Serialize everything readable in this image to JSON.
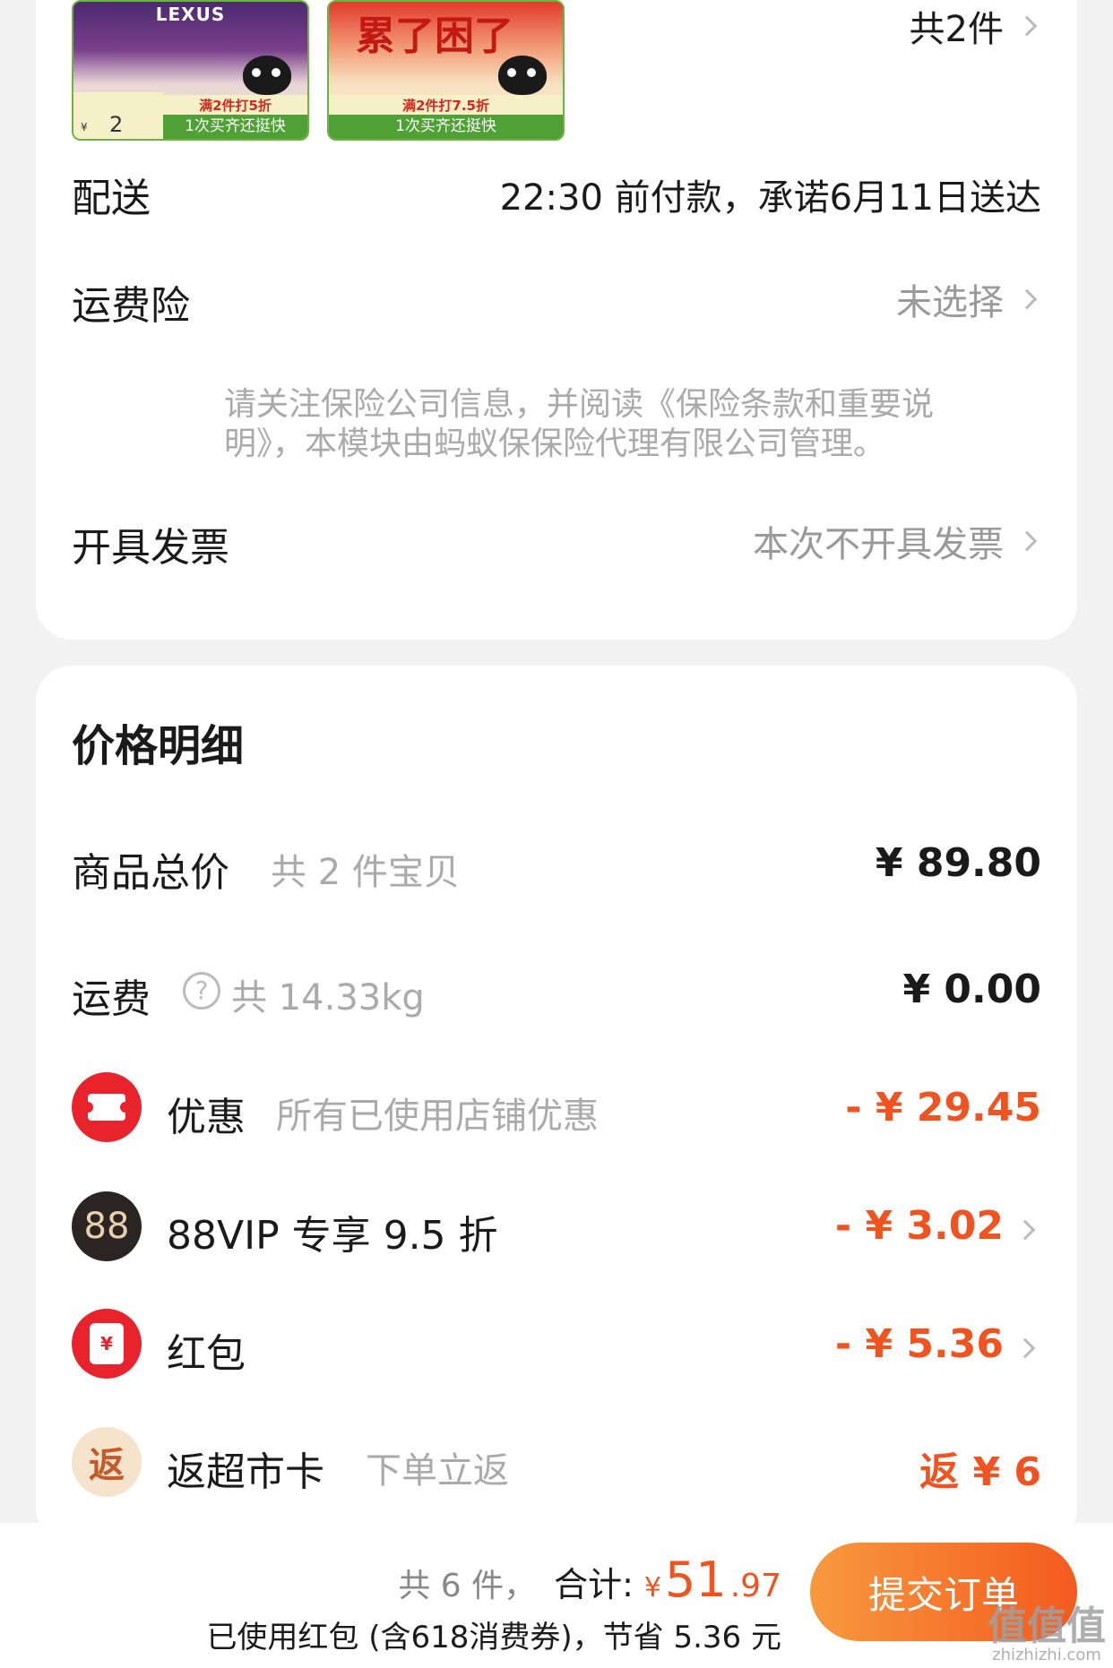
{
  "products": [
    {
      "brand": "LEXUS",
      "promo": "满2件打5折",
      "strip": "1次买齐还挺快",
      "price_currency": "¥",
      "price": "2"
    },
    {
      "headline": "累了困了",
      "promo": "满2件打7.5折",
      "strip": "1次买齐还挺快"
    }
  ],
  "item_count_link": "共2件",
  "delivery": {
    "label": "配送",
    "value": "22:30 前付款，承诺6月11日送达"
  },
  "insurance": {
    "label": "运费险",
    "value": "未选择",
    "note": "请关注保险公司信息，并阅读《保险条款和重要说明》，本模块由蚂蚁保保险代理有限公司管理。"
  },
  "invoice": {
    "label": "开具发票",
    "value": "本次不开具发票"
  },
  "price_detail": {
    "title": "价格明细",
    "goods_total": {
      "label": "商品总价",
      "sub": "共 2 件宝贝",
      "value": "¥ 89.80"
    },
    "shipping": {
      "label": "运费",
      "help": "?",
      "sub": "共 14.33kg",
      "value": "¥ 0.00"
    },
    "discount": {
      "label": "优惠",
      "sub": "所有已使用店铺优惠",
      "value": "- ¥ 29.45"
    },
    "vip": {
      "icon_text": "88",
      "label": "88VIP 专享 9.5 折",
      "value": "- ¥ 3.02"
    },
    "red_packet": {
      "icon_text": "¥",
      "label": "红包",
      "value": "- ¥ 5.36"
    },
    "cashback": {
      "icon_text": "返",
      "label": "返超市卡",
      "sub": "下单立返",
      "value": "返 ¥ 6"
    }
  },
  "footer": {
    "count": "共 6 件，",
    "total_label": "合计:",
    "currency": "¥",
    "total_int": "51",
    "total_dec": ".97",
    "savings": "已使用红包 (含618消费券)，节省 5.36 元",
    "submit": "提交订单"
  },
  "watermark": {
    "main": "值值值",
    "sub": "zhizhizhi.com"
  },
  "colors": {
    "accent": "#f0531f",
    "red": "#e8232b",
    "muted": "#aaaaaa"
  }
}
